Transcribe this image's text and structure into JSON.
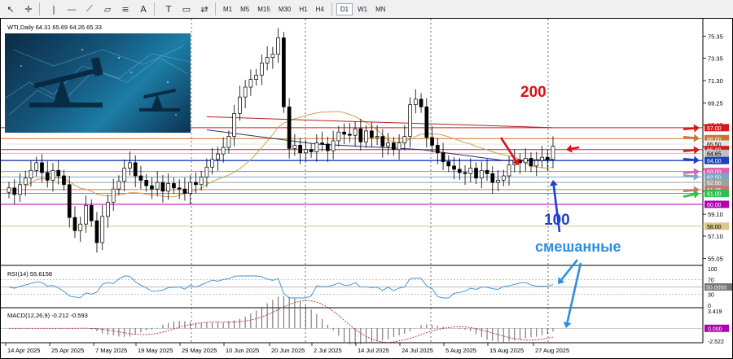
{
  "toolbar": {
    "tools": [
      {
        "icon": "cursor-icon",
        "glyph": "↖"
      },
      {
        "icon": "crosshair-icon",
        "glyph": "✛"
      },
      {
        "icon": "vertical-line-icon",
        "glyph": "|"
      },
      {
        "icon": "horizontal-line-icon",
        "glyph": "—"
      },
      {
        "icon": "trendline-icon",
        "glyph": "⟋"
      },
      {
        "icon": "channel-icon",
        "glyph": "▱"
      },
      {
        "icon": "fibonacci-icon",
        "glyph": "≡"
      },
      {
        "icon": "text-icon",
        "glyph": "A"
      },
      {
        "icon": "text-label-icon",
        "glyph": "T"
      },
      {
        "icon": "shapes-icon",
        "glyph": "▭"
      },
      {
        "icon": "arrows-icon",
        "glyph": "⇄"
      }
    ],
    "timeframes": [
      "M1",
      "M5",
      "M15",
      "M30",
      "H1",
      "H4",
      "D1",
      "W1",
      "MN"
    ],
    "active_timeframe": "D1"
  },
  "chart_header": "WTI,Daily  64.31 65.69 64.26 65.33",
  "price_labels": {
    "ticks": [
      "75.35",
      "73.35",
      "71.30",
      "69.25",
      "67.25",
      "65.25",
      "63.20",
      "61.20",
      "59.10",
      "57.10",
      "55.05"
    ],
    "badges": [
      {
        "text": "67.00",
        "value": 67.0,
        "color": "#d7191c"
      },
      {
        "text": "66.00",
        "value": 66.0,
        "color": "#c87533"
      },
      {
        "text": "65.50",
        "value": 65.5,
        "color": "#e6e6e6"
      },
      {
        "text": "65.00",
        "value": 65.0,
        "color": "#d7191c"
      },
      {
        "text": "64.65",
        "value": 64.65,
        "color": "#c0c0c0"
      },
      {
        "text": "64.00",
        "value": 64.0,
        "color": "#1f3fbf"
      },
      {
        "text": "63.00",
        "value": 63.0,
        "color": "#e05fb3"
      },
      {
        "text": "62.50",
        "value": 62.5,
        "color": "#7aa6c8"
      },
      {
        "text": "62.00",
        "value": 62.0,
        "color": "#a0a0a0"
      },
      {
        "text": "61.35",
        "value": 61.35,
        "color": "#c8786a"
      },
      {
        "text": "61.00",
        "value": 61.0,
        "color": "#2fbf4f"
      },
      {
        "text": "60.00",
        "value": 60.0,
        "color": "#b000b0"
      },
      {
        "text": "58.00",
        "value": 58.0,
        "color": "#d8c88a"
      }
    ]
  },
  "annotations": {
    "ma200": "200",
    "ma100": "100",
    "mixed": "смешанные"
  },
  "rsi": {
    "label": "RSI(14) 55.6158",
    "ticks": [
      "100",
      "70",
      "50.0000",
      "30",
      "0"
    ]
  },
  "macd": {
    "label": "MACD(12,26,9) -0.212 -0.593",
    "ticks": [
      "3.419",
      "0.000",
      "-2.522"
    ]
  },
  "dates": [
    "14 Apr 2025",
    "25 Apr 2025",
    "7 May 2025",
    "19 May 2025",
    "29 May 2025",
    "10 Jun 2025",
    "20 Jun 2025",
    "2 Jul 2025",
    "14 Jul 2025",
    "24 Jul 2025",
    "5 Aug 2025",
    "15 Aug 2025",
    "27 Aug 2025"
  ],
  "colors": {
    "ma200": "#b22222",
    "ma100": "#2b2b7a",
    "ma50": "#d4a04a",
    "rsi": "#3a8fd0",
    "macd_signal": "#b03030",
    "annotation_red": "#e0101a",
    "annotation_blue": "#1f3fcf",
    "annotation_cyan": "#2a8fe0"
  },
  "chart_data": {
    "type": "candlestick",
    "symbol": "WTI",
    "timeframe": "Daily",
    "last_ohlc": {
      "open": 64.31,
      "high": 65.69,
      "low": 64.26,
      "close": 65.33
    },
    "ylim": [
      54.5,
      76.5
    ],
    "closes": [
      61.5,
      60.9,
      61.8,
      62.4,
      63.1,
      63.8,
      62.9,
      62.2,
      63.1,
      62.6,
      61.8,
      58.8,
      57.6,
      58.2,
      59.9,
      58.5,
      56.5,
      58.9,
      60.2,
      61.4,
      62.1,
      63.3,
      63.8,
      62.6,
      62.2,
      61.7,
      61.4,
      62.0,
      61.2,
      61.9,
      61.5,
      61.4,
      61.0,
      62.0,
      61.8,
      62.5,
      63.4,
      64.1,
      64.6,
      65.2,
      66.2,
      68.3,
      69.8,
      70.7,
      71.4,
      71.8,
      72.9,
      73.4,
      73.7,
      75.2,
      68.9,
      65.1,
      65.4,
      64.7,
      65.0,
      64.8,
      65.6,
      65.5,
      64.9,
      65.8,
      66.6,
      66.4,
      66.3,
      66.9,
      65.7,
      66.7,
      66.1,
      66.2,
      65.3,
      65.6,
      65.0,
      65.6,
      66.2,
      69.1,
      69.6,
      68.9,
      66.1,
      65.4,
      64.7,
      63.9,
      63.5,
      63.2,
      62.9,
      62.8,
      63.3,
      62.4,
      63.1,
      62.8,
      62.0,
      62.2,
      62.6,
      63.6,
      64.0,
      63.8,
      64.2,
      63.5,
      64.0,
      64.3,
      64.1,
      65.3
    ]
  }
}
